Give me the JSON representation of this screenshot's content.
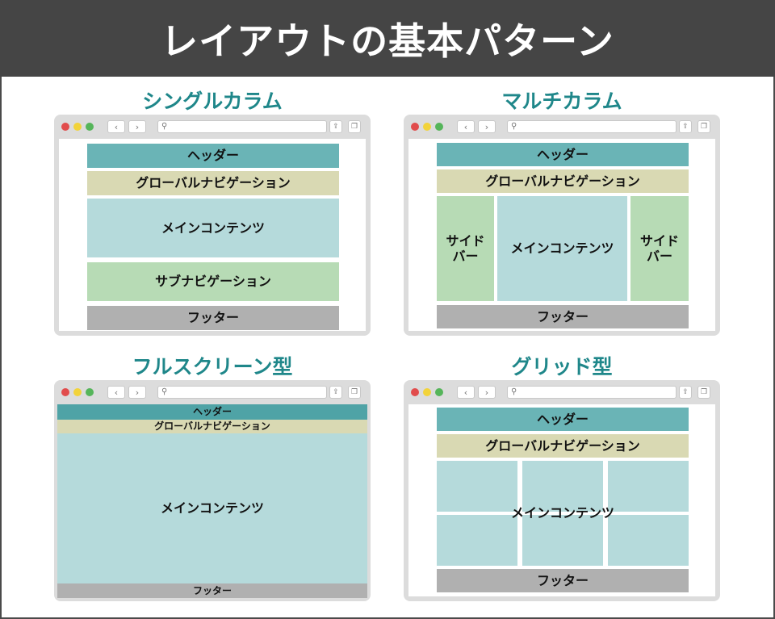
{
  "banner_title": "レイアウトの基本パターン",
  "colors": {
    "header": "#6ab4b6",
    "global_nav": "#d9d9b3",
    "main": "#b5dadb",
    "sub": "#b7dbb5",
    "footer": "#b0b0b0",
    "title": "#1f878a"
  },
  "browser": {
    "back_icon": "chevron-left-icon",
    "forward_icon": "chevron-right-icon",
    "search_icon": "magnifier-icon",
    "back_glyph": "‹",
    "forward_glyph": "›",
    "search_glyph": "⚲",
    "share_glyph": "⇪",
    "tabs_glyph": "❐"
  },
  "patterns": {
    "single": {
      "title": "シングルカラム",
      "header": "ヘッダー",
      "gnav": "グローバルナビゲーション",
      "main": "メインコンテンツ",
      "subnav": "サブナビゲーション",
      "footer": "フッター"
    },
    "multi": {
      "title": "マルチカラム",
      "header": "ヘッダー",
      "gnav": "グローバルナビゲーション",
      "side_left": "サイド\nバー",
      "main": "メインコンテンツ",
      "side_right": "サイド\nバー",
      "footer": "フッター"
    },
    "fullscreen": {
      "title": "フルスクリーン型",
      "header": "ヘッダー",
      "gnav": "グローバルナビゲーション",
      "main": "メインコンテンツ",
      "footer": "フッター"
    },
    "grid": {
      "title": "グリッド型",
      "header": "ヘッダー",
      "gnav": "グローバルナビゲーション",
      "main": "メインコンテンツ",
      "footer": "フッター"
    }
  }
}
